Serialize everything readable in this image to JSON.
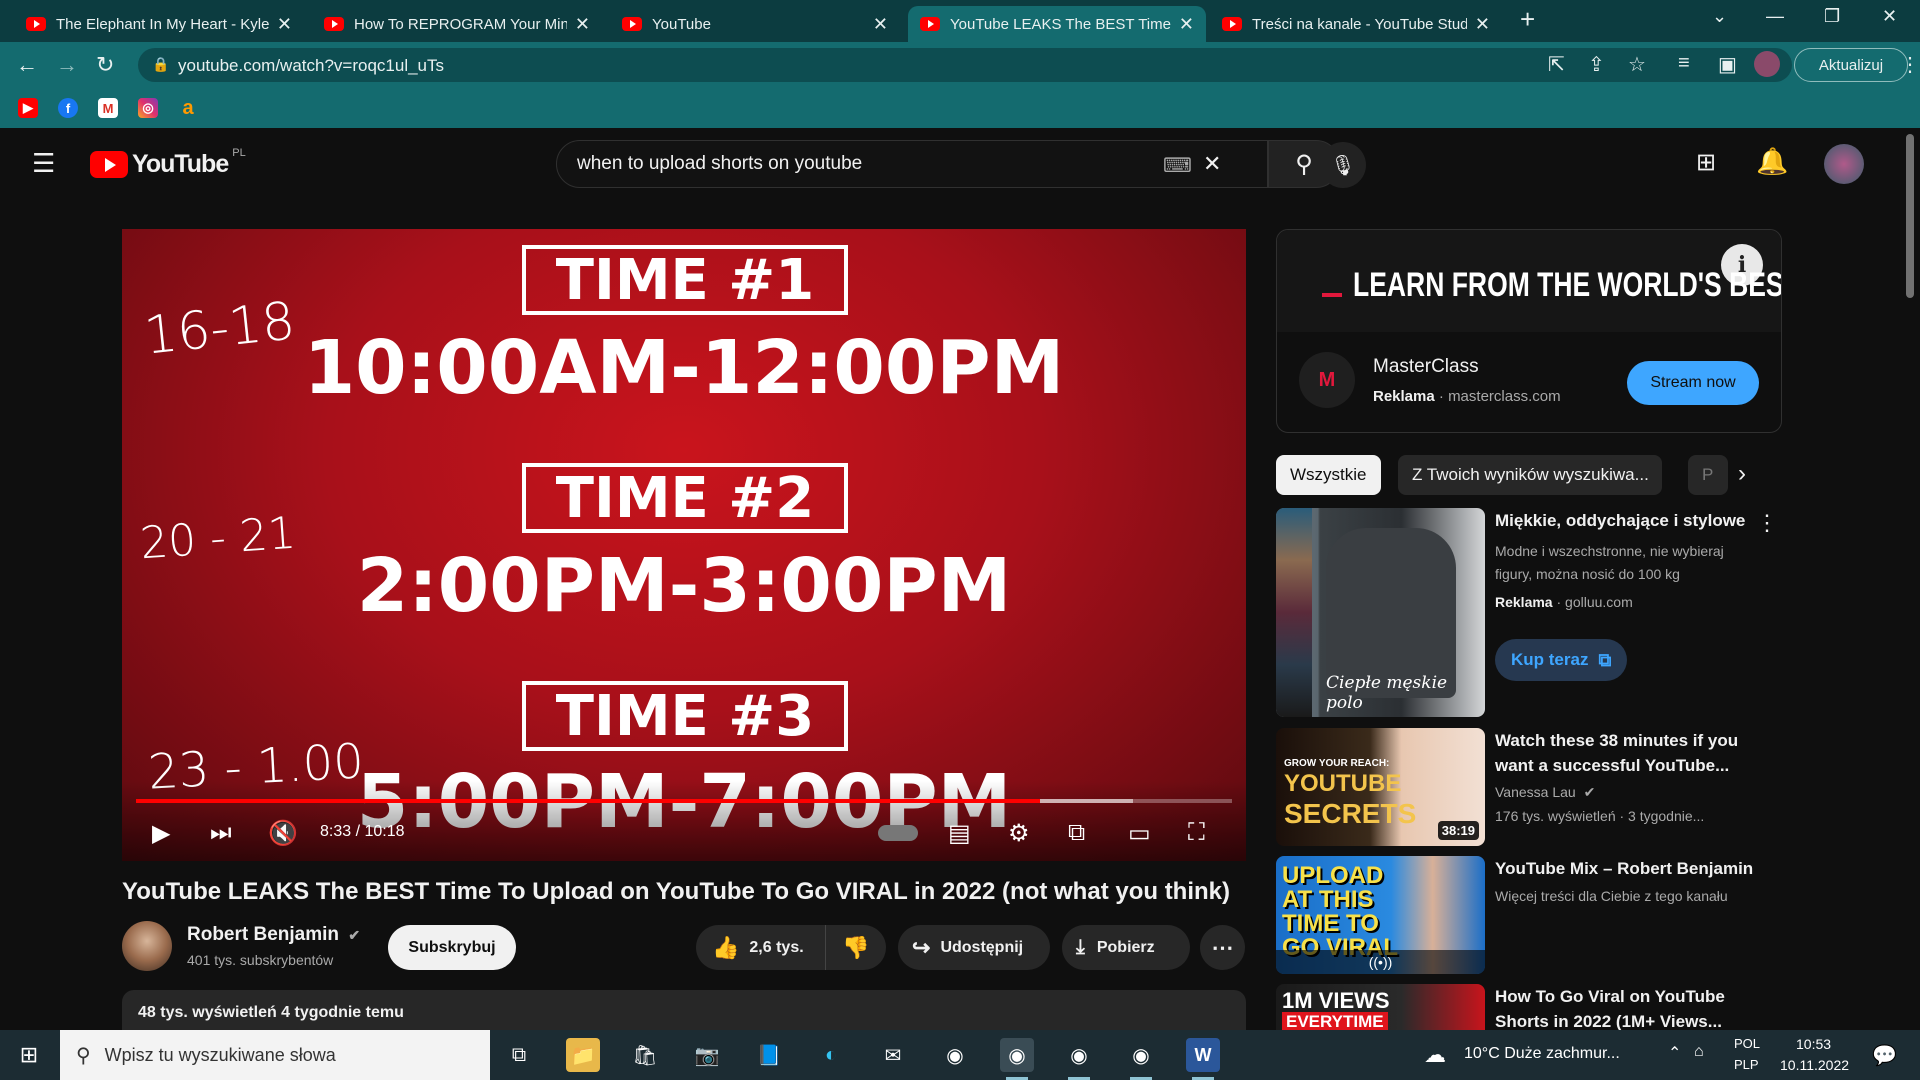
{
  "browser": {
    "tabs": [
      {
        "title": "The Elephant In My Heart - Kyle C",
        "active": false
      },
      {
        "title": "How To REPROGRAM Your Mind",
        "active": false
      },
      {
        "title": "YouTube",
        "active": false
      },
      {
        "title": "YouTube LEAKS The BEST Time To",
        "active": true
      },
      {
        "title": "Treści na kanale - YouTube Studio",
        "active": false
      }
    ],
    "url": "youtube.com/watch?v=roqc1ul_uTs",
    "update_label": "Aktualizuj"
  },
  "masthead": {
    "logo_text": "YouTube",
    "region": "PL",
    "search_value": "when to upload shorts on youtube"
  },
  "player": {
    "overlay": {
      "time1_label": "TIME #1",
      "time1_range": "10:00AM-12:00PM",
      "time2_label": "TIME #2",
      "time2_range": "2:00PM-3:00PM",
      "time3_label": "TIME #3",
      "time3_range": "5:00PM-7:00PM",
      "handwritten1": "16-18",
      "handwritten2": "20 - 21",
      "handwritten3": "23 - 1.00"
    },
    "time_display": "8:33 / 10:18",
    "progress_fraction": 0.825,
    "buffered_fraction": 0.91
  },
  "video": {
    "title": "YouTube LEAKS The BEST Time To Upload on YouTube To Go VIRAL in 2022 (not what you think)",
    "channel": "Robert Benjamin",
    "subscribers": "401 tys. subskrybentów",
    "subscribe_label": "Subskrybuj",
    "likes": "2,6 tys.",
    "share_label": "Udostępnij",
    "download_label": "Pobierz",
    "views_meta": "48 tys. wyświetleń  4 tygodnie temu"
  },
  "ad": {
    "headline": "LEARN FROM THE WORLD'S BEST",
    "advertiser": "MasterClass",
    "sponsor_label": "Reklama",
    "domain": "masterclass.com",
    "cta": "Stream now"
  },
  "chips": [
    "Wszystkie",
    "Z Twoich wyników wyszukiwa...",
    "P"
  ],
  "recommendations": [
    {
      "title": "Miękkie, oddychające i stylowe",
      "description": "Modne i wszechstronne, nie wybieraj figury, można nosić do 100 kg",
      "sponsor_label": "Reklama",
      "domain": "golluu.com",
      "cta": "Kup teraz",
      "thumb_caption": "Ciepłe męskie polo"
    },
    {
      "title": "Watch these 38 minutes if you want a successful YouTube...",
      "channel": "Vanessa Lau",
      "meta": "176 tys. wyświetleń · 3 tygodnie...",
      "duration": "38:19",
      "thumb_text_small": "GROW YOUR REACH:",
      "thumb_text_big1": "YOUTUBE",
      "thumb_text_big2": "SECRETS"
    },
    {
      "title": "YouTube Mix – Robert Benjamin",
      "channel": "Więcej treści dla Ciebie z tego kanału",
      "thumb_text": "UPLOAD AT THIS TIME TO GO VIRAL"
    },
    {
      "title": "How To Go Viral on YouTube Shorts in 2022 (1M+ Views...",
      "thumb_text1": "1M VIEWS",
      "thumb_text2": "EVERYTIME"
    }
  ],
  "taskbar": {
    "search_placeholder": "Wpisz tu wyszukiwane słowa",
    "weather": "10°C  Duże zachmur...",
    "lang_top": "POL",
    "lang_bottom": "PLP",
    "time": "10:53",
    "date": "10.11.2022"
  },
  "colors": {
    "chrome_frame": "#0c3c40",
    "chrome_toolbar": "#146b6f",
    "youtube_red": "#ff0000",
    "yt_background": "#0f0f0f",
    "stream_button": "#3ea6ff"
  }
}
